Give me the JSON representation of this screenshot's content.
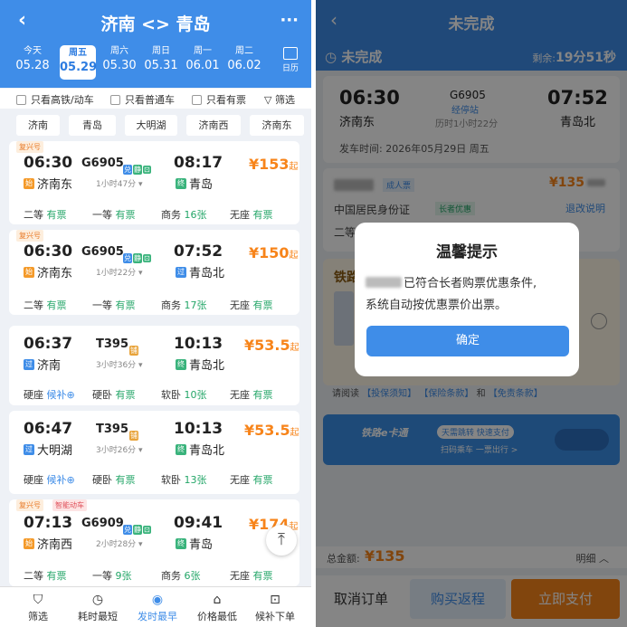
{
  "left": {
    "header": {
      "back": "‹",
      "title": "济南 <> 青岛",
      "more": "···"
    },
    "dates": [
      {
        "week": "今天",
        "date": "05.28"
      },
      {
        "week": "周五",
        "date": "05.29"
      },
      {
        "week": "周六",
        "date": "05.30"
      },
      {
        "week": "周日",
        "date": "05.31"
      },
      {
        "week": "周一",
        "date": "06.01"
      },
      {
        "week": "周二",
        "date": "06.02"
      }
    ],
    "calendar": "日历",
    "filters": {
      "f1": "只看高铁/动车",
      "f2": "只看普通车",
      "f3": "只看有票",
      "f4": "▽ 筛选"
    },
    "stations": [
      "济南",
      "青岛",
      "大明湖",
      "济南西",
      "济南东"
    ],
    "trains": [
      {
        "tag": "复兴号",
        "dep": "06:30",
        "no": "G6905",
        "dur": "1小时47分 ▾",
        "arr": "08:17",
        "from": "济南东",
        "from_b": "始",
        "to": "青岛",
        "to_b": "终",
        "price": "¥153",
        "qi": "起",
        "s1l": "二等",
        "s1v": "有票",
        "s2l": "一等",
        "s2v": "有票",
        "s3l": "商务",
        "s3v": "16张",
        "s4l": "无座",
        "s4v": "有票"
      },
      {
        "tag": "复兴号",
        "dep": "06:30",
        "no": "G6905",
        "dur": "1小时22分 ▾",
        "arr": "07:52",
        "from": "济南东",
        "from_b": "始",
        "to": "青岛北",
        "to_b": "过",
        "price": "¥150",
        "qi": "起",
        "s1l": "二等",
        "s1v": "有票",
        "s2l": "一等",
        "s2v": "有票",
        "s3l": "商务",
        "s3v": "17张",
        "s4l": "无座",
        "s4v": "有票"
      },
      {
        "tag": "",
        "dep": "06:37",
        "no": "T395",
        "dur": "3小时36分 ▾",
        "arr": "10:13",
        "from": "济南",
        "from_b": "过",
        "to": "青岛北",
        "to_b": "终",
        "price": "¥53.5",
        "qi": "起",
        "s1l": "硬座",
        "s1v": "候补",
        "s2l": "硬卧",
        "s2v": "有票",
        "s3l": "软卧",
        "s3v": "10张",
        "s4l": "无座",
        "s4v": "有票"
      },
      {
        "tag": "",
        "dep": "06:47",
        "no": "T395",
        "dur": "3小时26分 ▾",
        "arr": "10:13",
        "from": "大明湖",
        "from_b": "过",
        "to": "青岛北",
        "to_b": "终",
        "price": "¥53.5",
        "qi": "起",
        "s1l": "硬座",
        "s1v": "候补",
        "s2l": "硬卧",
        "s2v": "有票",
        "s3l": "软卧",
        "s3v": "13张",
        "s4l": "无座",
        "s4v": "有票"
      },
      {
        "tag": "复兴号",
        "tag2": "智能动车",
        "dep": "07:13",
        "no": "G6909",
        "dur": "2小时28分 ▾",
        "arr": "09:41",
        "from": "济南西",
        "from_b": "始",
        "to": "青岛",
        "to_b": "终",
        "price": "¥174",
        "qi": "起",
        "s1l": "二等",
        "s1v": "有票",
        "s2l": "一等",
        "s2v": "9张",
        "s3l": "商务",
        "s3v": "6张",
        "s4l": "无座",
        "s4v": "有票"
      }
    ],
    "badges": {
      "fu": "兑",
      "jing": "静",
      "wifi": "⊡",
      "wo": "铺"
    },
    "bottom": [
      "筛选",
      "耗时最短",
      "发时最早",
      "价格最低",
      "候补下单"
    ]
  },
  "right": {
    "header": {
      "back": "‹",
      "title": "未完成"
    },
    "status": "未完成",
    "remain_label": "剩余:",
    "remain": "19分51秒",
    "dep": "06:30",
    "from": "济南东",
    "no": "G6905",
    "via": "经停站",
    "dur": "历时1小时22分",
    "arr": "07:52",
    "to": "青岛北",
    "dep_time_label": "发车时间:",
    "dep_time": "2026年05月29日 周五",
    "passenger_type": "成人票",
    "price": "¥135",
    "id_type": "中国居民身份证",
    "senior": "长者优惠",
    "change": "退改说明",
    "seat_prefix": "二等",
    "ins_title": "铁路",
    "read_label": "请阅读",
    "read1": "【投保须知】",
    "read2": "【保险条款】",
    "and": "和",
    "read3": "【免责条款】",
    "banner_title": "天需跳转 快速支付",
    "banner_sub": "扫码乘车  一票出行 >",
    "banner_brand": "铁路e卡通",
    "total_label": "总金额:",
    "total": "¥135",
    "detail": "明细 ︿",
    "cancel": "取消订单",
    "roundtrip": "购买返程",
    "pay": "立即支付",
    "dialog": {
      "title": "温馨提示",
      "line1": "已符合长者购票优惠条件,",
      "line2": "系统自动按优惠票价出票。",
      "ok": "确定"
    }
  }
}
